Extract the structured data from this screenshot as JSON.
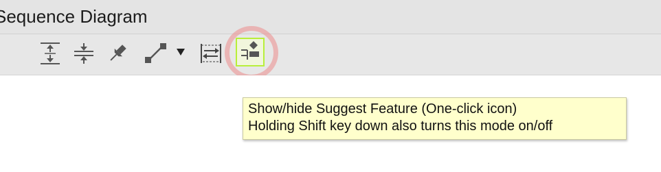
{
  "window": {
    "title": "Sequence Diagram"
  },
  "toolbar": {
    "items": [
      {
        "name": "expand-space-icon"
      },
      {
        "name": "collapse-space-icon"
      },
      {
        "name": "pin-icon"
      },
      {
        "name": "connector-icon"
      },
      {
        "name": "connector-dropdown-icon"
      },
      {
        "name": "fit-frame-icon"
      },
      {
        "name": "suggest-feature-icon",
        "selected": true
      }
    ]
  },
  "tooltip": {
    "line1": "Show/hide Suggest Feature (One-click icon)",
    "line2": "Holding Shift key down also turns this mode on/off"
  },
  "colors": {
    "highlight_ring": "#ed8c8c",
    "selected_border": "#b8ef3a",
    "tooltip_bg": "#ffffcc",
    "icon": "#555555"
  }
}
